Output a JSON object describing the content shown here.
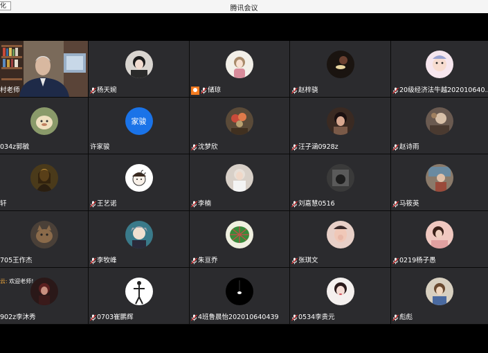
{
  "window": {
    "title": "腾讯会议",
    "left_tab": "化"
  },
  "colors": {
    "tile_bg": "#2b2b2e",
    "blue_avatar": "#1a73e8",
    "chat_tag": "#f3a93c"
  },
  "participants": [
    {
      "name": "村老师",
      "type": "video",
      "mic": "none"
    },
    {
      "name": "杨天婉",
      "avatar": "girl-photo",
      "mic": "muted"
    },
    {
      "name": "储琼",
      "avatar": "cartoon-girl",
      "mic": "muted",
      "badge": "host-icon"
    },
    {
      "name": "赵梓骁",
      "avatar": "dark-moon",
      "mic": "muted"
    },
    {
      "name": "20级经济法牛越202010640...",
      "avatar": "baby-photo",
      "mic": "muted"
    },
    {
      "name": "034z郭毓",
      "avatar": "cartoon-cat",
      "mic": "none"
    },
    {
      "name": "许家骏",
      "avatar": "initials",
      "initials": "家骏",
      "mic": "none"
    },
    {
      "name": "沈梦欣",
      "avatar": "flowers",
      "mic": "muted"
    },
    {
      "name": "汪子涵0928z",
      "avatar": "woman-photo",
      "mic": "muted"
    },
    {
      "name": "赵诗雨",
      "avatar": "anime-photo",
      "mic": "muted"
    },
    {
      "name": "轩",
      "avatar": "mona-lisa",
      "mic": "none"
    },
    {
      "name": "王艺诺",
      "avatar": "cartoon-face",
      "mic": "muted"
    },
    {
      "name": "李楠",
      "avatar": "girl-light",
      "mic": "muted"
    },
    {
      "name": "刘嘉慧0516",
      "avatar": "gray-photo",
      "mic": "muted"
    },
    {
      "name": "马筱英",
      "avatar": "street-photo",
      "mic": "muted"
    },
    {
      "name": "705王作杰",
      "avatar": "cat-photo",
      "mic": "none"
    },
    {
      "name": "李牧峰",
      "avatar": "anime-boy",
      "mic": "muted"
    },
    {
      "name": "朱亘乔",
      "avatar": "leaf",
      "mic": "muted"
    },
    {
      "name": "张琪文",
      "avatar": "hands-photo",
      "mic": "muted"
    },
    {
      "name": "0219杨子愚",
      "avatar": "girl-pink",
      "mic": "muted"
    },
    {
      "name": "902z李沐秀",
      "avatar": "girl-dark",
      "mic": "none",
      "chat": {
        "tag": "云: ",
        "text": "欢迎老师!"
      }
    },
    {
      "name": "0703崔鹏辉",
      "avatar": "figure-white",
      "mic": "muted"
    },
    {
      "name": "4班鲁晨怡202010640439",
      "avatar": "lamp",
      "mic": "muted"
    },
    {
      "name": "0534李贵元",
      "avatar": "girl-white",
      "mic": "muted"
    },
    {
      "name": "彪彪",
      "avatar": "boy-photo",
      "mic": "muted"
    }
  ]
}
